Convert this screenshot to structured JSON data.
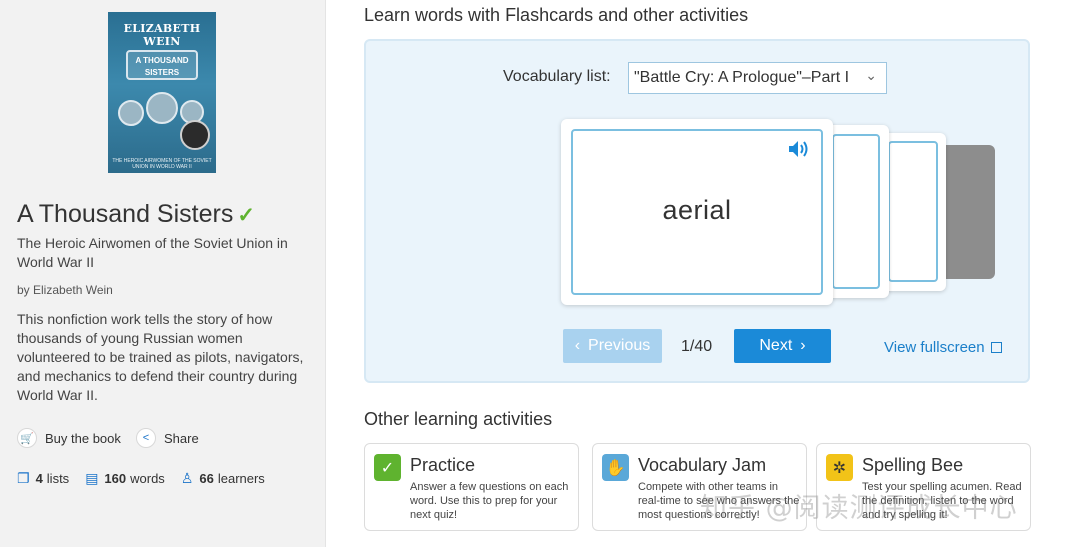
{
  "sidebar": {
    "cover": {
      "author": "ELIZABETH WEIN",
      "title_line1": "A THOUSAND",
      "title_line2": "SISTERS",
      "subtitle": "THE HEROIC AIRWOMEN OF THE SOVIET UNION IN WORLD WAR II"
    },
    "title": "A Thousand Sisters",
    "subtitle": "The Heroic Airwomen of the Soviet Union in World War II",
    "author": "by Elizabeth Wein",
    "description": "This nonfiction work tells the story of how thousands of young Russian women volunteered to be trained as pilots, navigators, and mechanics to defend their country during World War II.",
    "buy_label": "Buy the book",
    "share_label": "Share",
    "stats": {
      "lists_count": "4",
      "lists_label": "lists",
      "words_count": "160",
      "words_label": "words",
      "learners_count": "66",
      "learners_label": "learners"
    }
  },
  "main": {
    "heading": "Learn words with Flashcards and other activities",
    "vocab_label": "Vocabulary list:",
    "vocab_selected": "\"Battle Cry: A Prologue\"–Part I",
    "card_word": "aerial",
    "prev_label": "Previous",
    "counter": "1/40",
    "next_label": "Next",
    "fullscreen_label": "View fullscreen"
  },
  "activities": {
    "heading": "Other learning activities",
    "items": [
      {
        "title": "Practice",
        "desc": "Answer a few questions on each word. Use this to prep for your next quiz!",
        "color": "#5fb32f"
      },
      {
        "title": "Vocabulary Jam",
        "desc": "Compete with other teams in real-time to see who answers the most questions correctly!",
        "color": "#5aa8d8"
      },
      {
        "title": "Spelling Bee",
        "desc": "Test your spelling acumen. Read the definition, listen to the word and try spelling it!",
        "color": "#f2c318"
      }
    ]
  },
  "watermark": "知乎 @阅读测评成长中心"
}
